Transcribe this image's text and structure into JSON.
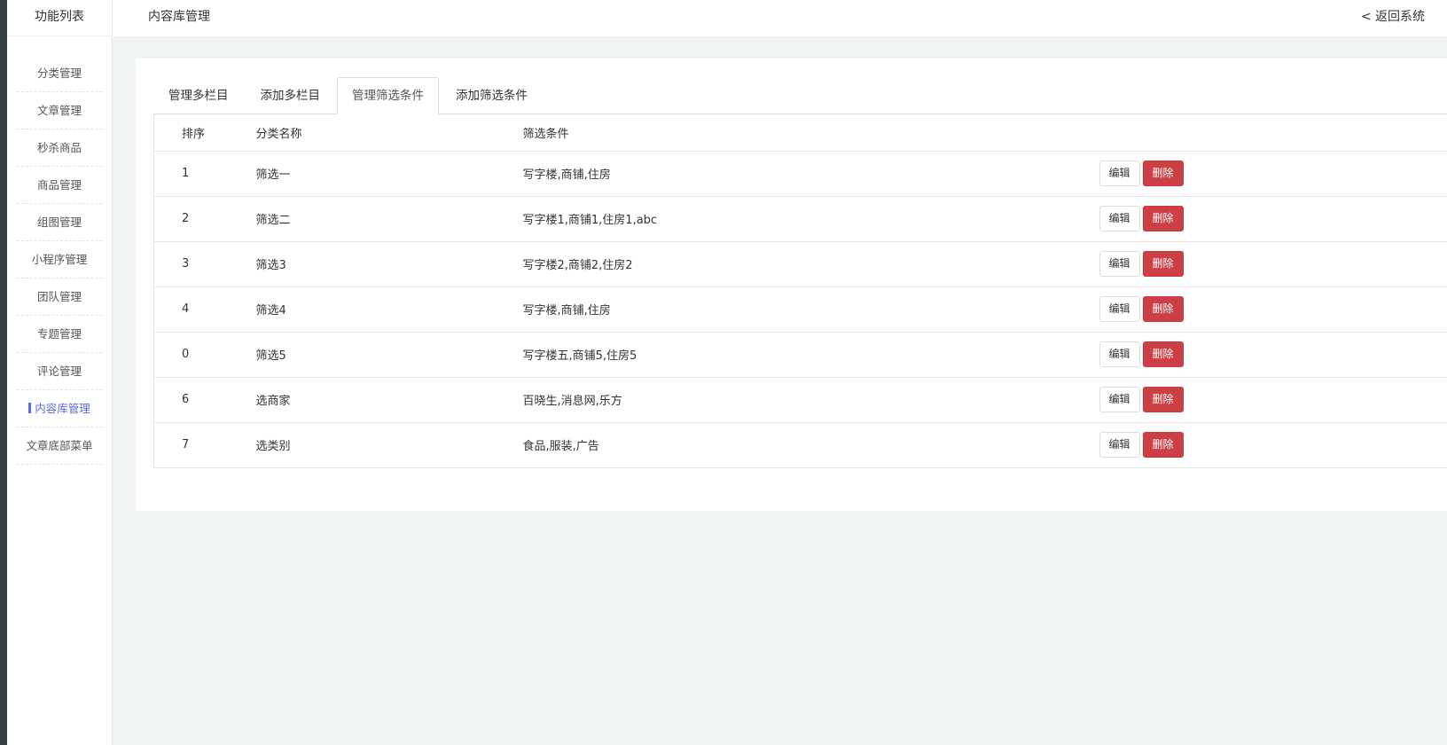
{
  "sidebar": {
    "title": "功能列表",
    "items": [
      "分类管理",
      "文章管理",
      "秒杀商品",
      "商品管理",
      "组图管理",
      "小程序管理",
      "团队管理",
      "专题管理",
      "评论管理",
      "内容库管理",
      "文章底部菜单"
    ],
    "active_index": 9
  },
  "header": {
    "title": "内容库管理",
    "back_label": "< 返回系统"
  },
  "tabs": [
    "管理多栏目",
    "添加多栏目",
    "管理筛选条件",
    "添加筛选条件"
  ],
  "active_tab": 2,
  "table": {
    "headers": [
      "排序",
      "分类名称",
      "筛选条件"
    ],
    "rows": [
      {
        "order": "1",
        "name": "筛选一",
        "conditions": "写字楼,商铺,住房"
      },
      {
        "order": "2",
        "name": "筛选二",
        "conditions": "写字楼1,商铺1,住房1,abc"
      },
      {
        "order": "3",
        "name": "筛选3",
        "conditions": "写字楼2,商铺2,住房2"
      },
      {
        "order": "4",
        "name": "筛选4",
        "conditions": "写字楼,商铺,住房"
      },
      {
        "order": "0",
        "name": "筛选5",
        "conditions": "写字楼五,商铺5,住房5"
      },
      {
        "order": "6",
        "name": "选商家",
        "conditions": "百晓生,消息网,乐方"
      },
      {
        "order": "7",
        "name": "选类别",
        "conditions": "食品,服装,广告"
      }
    ]
  },
  "actions": {
    "edit_label": "编辑",
    "delete_label": "删除"
  },
  "colors": {
    "accent": "#5b6be0",
    "danger": "#cc4045"
  }
}
